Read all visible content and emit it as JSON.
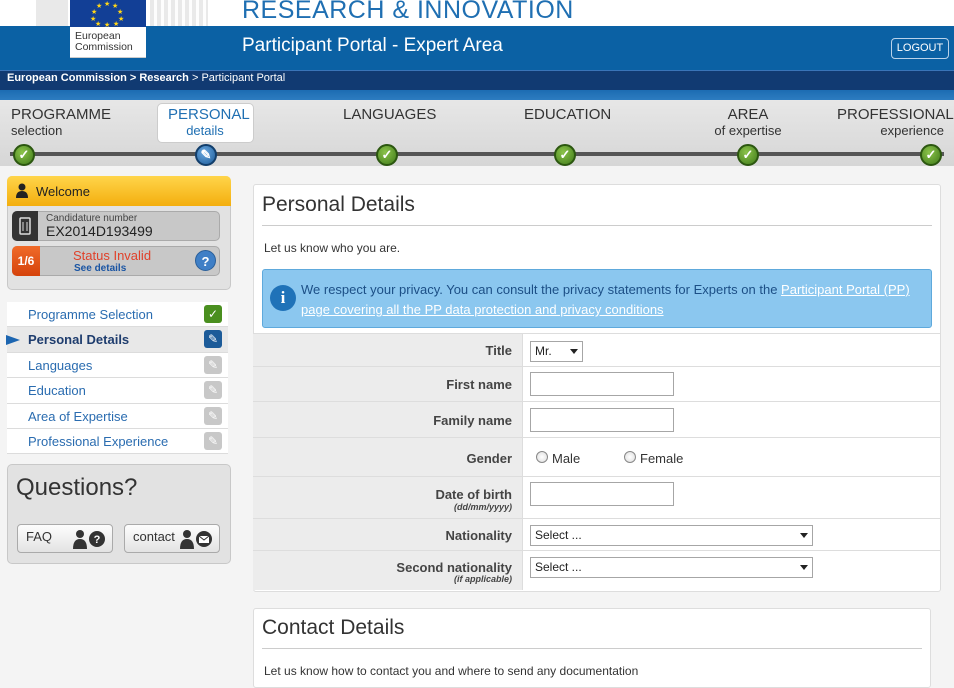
{
  "header": {
    "logo_line1": "European",
    "logo_line2": "Commission",
    "section_title": "RESEARCH & INNOVATION",
    "portal_title": "Participant Portal - Expert Area",
    "logout_label": "LOGOUT",
    "brand_color": "#0b61a4"
  },
  "breadcrumb": {
    "item1": "European Commission",
    "sep1": " > ",
    "item2": "Research",
    "sep2": " > ",
    "item3": "Participant Portal"
  },
  "steps": [
    {
      "label": "PROGRAMME",
      "sub": "selection",
      "state": "done"
    },
    {
      "label": "PERSONAL",
      "sub": "details",
      "state": "active"
    },
    {
      "label": "LANGUAGES",
      "sub": "",
      "state": "done"
    },
    {
      "label": "EDUCATION",
      "sub": "",
      "state": "done"
    },
    {
      "label": "AREA",
      "sub": "of expertise",
      "state": "done"
    },
    {
      "label": "PROFESSIONAL",
      "sub": "experience",
      "state": "done"
    }
  ],
  "sidebar": {
    "welcome": "Welcome",
    "candidature_label": "Candidature number",
    "candidature_number": "EX2014D193499",
    "status_fraction": "1/6",
    "status_text": "Status Invalid",
    "status_link": "See details",
    "help": "?",
    "nav": [
      {
        "label": "Programme Selection",
        "icon": "check-icon"
      },
      {
        "label": "Personal Details",
        "icon": "pencil-icon",
        "active": true
      },
      {
        "label": "Languages",
        "icon": "pencil-icon"
      },
      {
        "label": "Education",
        "icon": "pencil-icon"
      },
      {
        "label": "Area of Expertise",
        "icon": "pencil-icon"
      },
      {
        "label": "Professional Experience",
        "icon": "pencil-icon"
      }
    ],
    "questions_title": "Questions?",
    "faq_label": "FAQ",
    "contact_label": "contact"
  },
  "personal": {
    "title": "Personal Details",
    "intro": "Let us know who you are.",
    "privacy_text": "We respect your privacy. You can consult the privacy statements for Experts on the ",
    "privacy_link": "Participant Portal (PP) page covering all the PP data protection and privacy conditions",
    "fields": {
      "title_label": "Title",
      "title_value": "Mr.",
      "first_name_label": "First name",
      "family_name_label": "Family name",
      "gender_label": "Gender",
      "gender_male": "Male",
      "gender_female": "Female",
      "dob_label": "Date of birth",
      "dob_hint": "(dd/mm/yyyy)",
      "nationality_label": "Nationality",
      "nationality_value": "Select ...",
      "second_nationality_label": "Second nationality",
      "second_nationality_hint": "(if applicable)",
      "second_nationality_value": "Select ..."
    }
  },
  "contact": {
    "title": "Contact Details",
    "intro": "Let us know how to contact you and where to send any documentation"
  }
}
